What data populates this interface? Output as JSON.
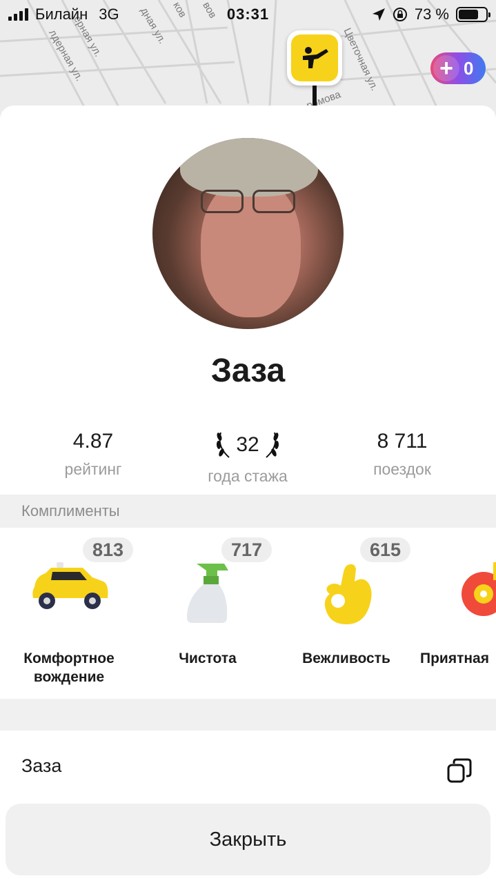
{
  "status_bar": {
    "carrier": "Билайн",
    "network": "3G",
    "time": "03:31",
    "battery_percent_label": "73 %",
    "battery_level": 0.73
  },
  "map": {
    "streets": [
      "лдерная ул.",
      "ерная ул.",
      "дная ул.",
      "ков",
      "вов",
      "Цветочная ул.",
      "ромова"
    ],
    "pin_icon": "hailing-person-icon",
    "plus_badge": {
      "icon": "plus-icon",
      "value": "0"
    }
  },
  "driver": {
    "name": "Заза",
    "stats": [
      {
        "value": "4.87",
        "label": "рейтинг"
      },
      {
        "value": "32",
        "label": "года стажа",
        "icon": "laurel-icon"
      },
      {
        "value": "8 711",
        "label": "поездок"
      }
    ]
  },
  "compliments": {
    "title": "Комплименты",
    "items": [
      {
        "count": "813",
        "label": "Комфортное вождение",
        "icon": "taxi-car-icon"
      },
      {
        "count": "717",
        "label": "Чистота",
        "icon": "spray-bottle-icon"
      },
      {
        "count": "615",
        "label": "Вежливость",
        "icon": "ok-hand-icon"
      },
      {
        "count": "",
        "label": "Приятная",
        "icon": "music-disc-icon"
      }
    ]
  },
  "copy_row": {
    "text": "Заза",
    "icon": "copy-icon"
  },
  "close_button": {
    "label": "Закрыть"
  },
  "colors": {
    "taxi_yellow": "#f7d21a",
    "sheet_bg": "#ffffff",
    "band_bg": "#f0f0f0",
    "muted_text": "#9b9b9b"
  }
}
